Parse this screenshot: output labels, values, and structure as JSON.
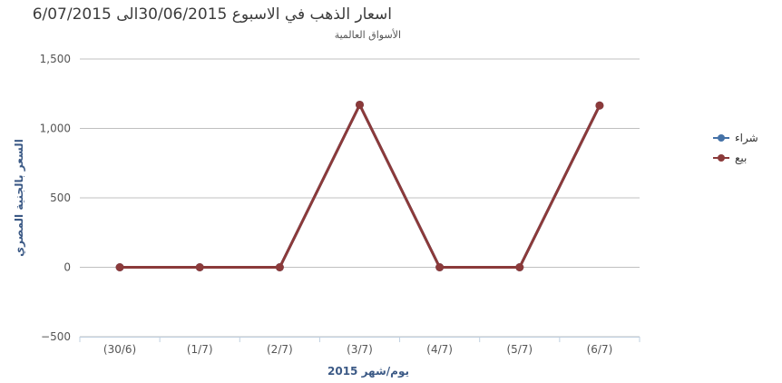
{
  "chart_data": {
    "type": "line",
    "title": "اسعار الذهب في الاسبوع 30/06/2015الى 6/07/2015",
    "subtitle": "الأسواق العالمية",
    "xlabel": "يوم/شهر 2015",
    "ylabel": "السعر بالجنية المصري",
    "categories": [
      "(30/6)",
      "(1/7)",
      "(2/7)",
      "(3/7)",
      "(4/7)",
      "(5/7)",
      "(6/7)"
    ],
    "yticks": [
      "−500",
      "0",
      "500",
      "1,000",
      "1,500"
    ],
    "ylim": [
      -500,
      1500
    ],
    "series": [
      {
        "name": "شراء",
        "color": "#4572a7",
        "values": [
          0,
          0,
          0,
          1170,
          0,
          0,
          1165
        ]
      },
      {
        "name": "بيع",
        "color": "#8b3a3a",
        "values": [
          0,
          0,
          0,
          1170,
          0,
          0,
          1165
        ]
      }
    ],
    "legend_position": "right",
    "grid": true
  }
}
